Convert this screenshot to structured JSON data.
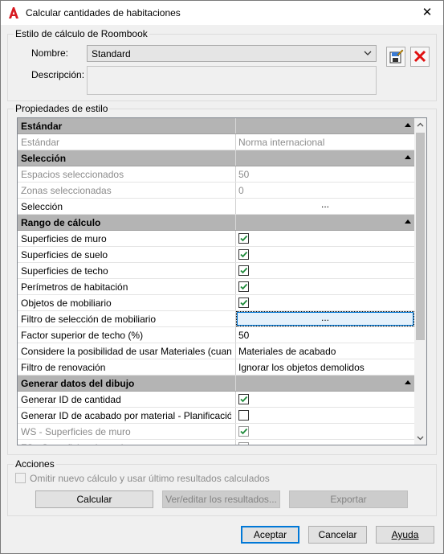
{
  "window": {
    "title": "Calcular cantidades de habitaciones",
    "close_label": "✕"
  },
  "style_group": {
    "label": "Estilo de cálculo de Roombook",
    "name_label": "Nombre:",
    "name_value": "Standard",
    "desc_label": "Descripción:"
  },
  "props_group": {
    "label": "Propiedades de estilo"
  },
  "grid": {
    "rows": [
      {
        "type": "cat",
        "name": "Estándar"
      },
      {
        "type": "prop",
        "name": "Estándar",
        "value": "Norma internacional",
        "disabled": true
      },
      {
        "type": "cat",
        "name": "Selección"
      },
      {
        "type": "prop",
        "name": "Espacios seleccionados",
        "value": "50",
        "disabled": true
      },
      {
        "type": "prop",
        "name": "Zonas seleccionadas",
        "value": "0",
        "disabled": true
      },
      {
        "type": "ellipsis",
        "name": "Selección",
        "value": "..."
      },
      {
        "type": "cat",
        "name": "Rango de cálculo"
      },
      {
        "type": "check",
        "name": "Superficies de muro",
        "checked": true
      },
      {
        "type": "check",
        "name": "Superficies de suelo",
        "checked": true
      },
      {
        "type": "check",
        "name": "Superficies de techo",
        "checked": true
      },
      {
        "type": "check",
        "name": "Perímetros de habitación",
        "checked": true
      },
      {
        "type": "check",
        "name": "Objetos de mobiliario",
        "checked": true
      },
      {
        "type": "ellipsis",
        "name": "Filtro de selección de mobiliario",
        "value": "...",
        "selected": true
      },
      {
        "type": "prop",
        "name": "Factor superior de techo (%)",
        "value": "50"
      },
      {
        "type": "prop",
        "name": "Considere la posibilidad de usar Materiales (cuand",
        "value": "Materiales de acabado"
      },
      {
        "type": "prop",
        "name": "Filtro de renovación",
        "value": "Ignorar los objetos demolidos"
      },
      {
        "type": "cat",
        "name": "Generar datos del dibujo"
      },
      {
        "type": "check",
        "name": "Generar ID de cantidad",
        "checked": true
      },
      {
        "type": "check",
        "name": "Generar ID de acabado por material - Planificación",
        "checked": false
      },
      {
        "type": "check",
        "name": "WS - Superficies de muro",
        "checked": true,
        "disabled": true
      },
      {
        "type": "check",
        "name": "FS - Superficies de suelo",
        "checked": true,
        "disabled": true
      }
    ]
  },
  "actions_group": {
    "label": "Acciones",
    "omit_label": "Omitir nuevo cálculo y usar último resultados calculados",
    "calc_label": "Calcular",
    "view_label": "Ver/editar los resultados...",
    "export_label": "Exportar"
  },
  "footer": {
    "accept_label": "Aceptar",
    "cancel_label": "Cancelar",
    "help_label": "Ayuda"
  }
}
